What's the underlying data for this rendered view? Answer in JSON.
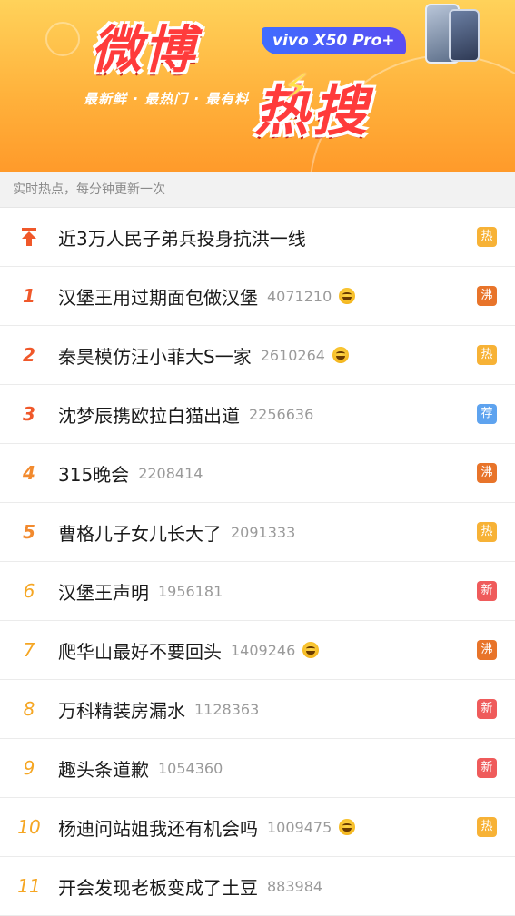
{
  "banner": {
    "title_main": "微博",
    "title_sub": "热搜",
    "tagline": "最新鲜 · 最热门 · 最有料",
    "promo": "vivo X50 Pro+"
  },
  "subheader": "实时热点，每分钟更新一次",
  "badges": {
    "hot": "热",
    "boil": "沸",
    "rec": "荐",
    "new": "新"
  },
  "colors": {
    "rank_top": "#f0582a",
    "hot": "#f7b236",
    "boil": "#e8742a",
    "rec": "#5ea3ef",
    "new": "#ef5b5b"
  },
  "pinned": {
    "topic": "近3万人民子弟兵投身抗洪一线",
    "badge": "热"
  },
  "items": [
    {
      "rank": "1",
      "topic": "汉堡王用过期面包做汉堡",
      "count": "4071210",
      "emoji": true,
      "badge": "沸"
    },
    {
      "rank": "2",
      "topic": "秦昊模仿汪小菲大S一家",
      "count": "2610264",
      "emoji": true,
      "badge": "热"
    },
    {
      "rank": "3",
      "topic": "沈梦辰携欧拉白猫出道",
      "count": "2256636",
      "emoji": false,
      "badge": "荐"
    },
    {
      "rank": "4",
      "topic": "315晚会",
      "count": "2208414",
      "emoji": false,
      "badge": "沸"
    },
    {
      "rank": "5",
      "topic": "曹格儿子女儿长大了",
      "count": "2091333",
      "emoji": false,
      "badge": "热"
    },
    {
      "rank": "6",
      "topic": "汉堡王声明",
      "count": "1956181",
      "emoji": false,
      "badge": "新"
    },
    {
      "rank": "7",
      "topic": "爬华山最好不要回头",
      "count": "1409246",
      "emoji": true,
      "badge": "沸"
    },
    {
      "rank": "8",
      "topic": "万科精装房漏水",
      "count": "1128363",
      "emoji": false,
      "badge": "新"
    },
    {
      "rank": "9",
      "topic": "趣头条道歉",
      "count": "1054360",
      "emoji": false,
      "badge": "新"
    },
    {
      "rank": "10",
      "topic": "杨迪问站姐我还有机会吗",
      "count": "1009475",
      "emoji": true,
      "badge": "热"
    },
    {
      "rank": "11",
      "topic": "开会发现老板变成了土豆",
      "count": "883984",
      "emoji": false,
      "badge": ""
    }
  ]
}
